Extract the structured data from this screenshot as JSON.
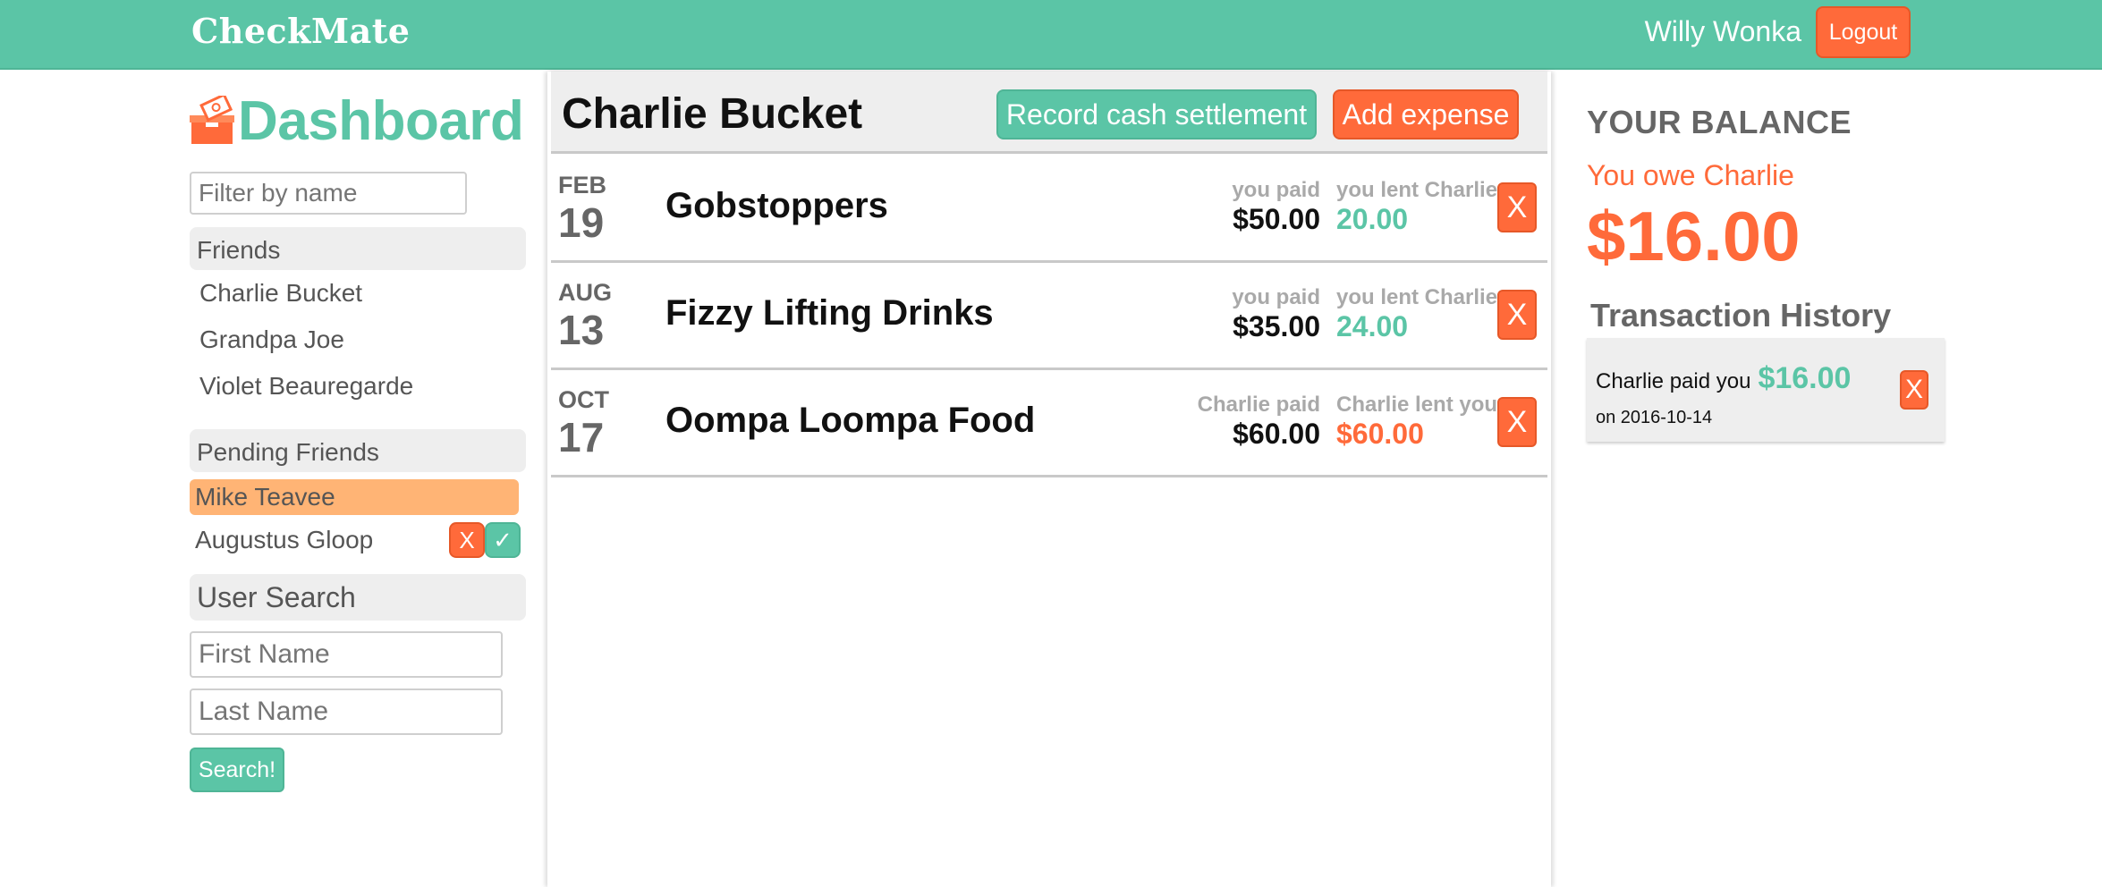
{
  "app": {
    "brand": "CheckMate"
  },
  "header": {
    "username": "Willy Wonka",
    "logout_label": "Logout"
  },
  "sidebar": {
    "title": "Dashboard",
    "filter_placeholder": "Filter by name",
    "friends_header": "Friends",
    "friends": [
      {
        "name": "Charlie Bucket"
      },
      {
        "name": "Grandpa Joe"
      },
      {
        "name": "Violet Beauregarde"
      }
    ],
    "pending_header": "Pending Friends",
    "pending": [
      {
        "name": "Mike Teavee"
      },
      {
        "name": "Augustus Gloop",
        "reject_label": "X",
        "accept_label": "✓"
      }
    ],
    "user_search_header": "User Search",
    "first_name_placeholder": "First Name",
    "last_name_placeholder": "Last Name",
    "search_label": "Search!"
  },
  "main": {
    "friend_name": "Charlie Bucket",
    "settle_label": "Record cash settlement",
    "add_expense_label": "Add expense",
    "expenses": [
      {
        "month": "FEB",
        "day": "19",
        "title": "Gobstoppers",
        "paid_label": "you paid",
        "paid_amount": "$50.00",
        "lent_label": "you lent Charlie",
        "lent_amount": "20.00",
        "lent_color": "green",
        "delete_label": "X"
      },
      {
        "month": "AUG",
        "day": "13",
        "title": "Fizzy Lifting Drinks",
        "paid_label": "you paid",
        "paid_amount": "$35.00",
        "lent_label": "you lent Charlie",
        "lent_amount": "24.00",
        "lent_color": "green",
        "delete_label": "X"
      },
      {
        "month": "OCT",
        "day": "17",
        "title": "Oompa Loompa Food",
        "paid_label": "Charlie paid",
        "paid_amount": "$60.00",
        "lent_label": "Charlie lent you",
        "lent_amount": "$60.00",
        "lent_color": "orange",
        "delete_label": "X"
      }
    ]
  },
  "balance": {
    "title": "YOUR BALANCE",
    "subtitle": "You owe Charlie",
    "amount": "$16.00"
  },
  "history": {
    "title": "Transaction History",
    "items": [
      {
        "text": "Charlie paid you",
        "amount": "$16.00",
        "date": "on 2016-10-14",
        "delete_label": "X"
      }
    ]
  },
  "colors": {
    "accent_green": "#5bc5a6",
    "accent_orange": "#ff6a3a",
    "pending_highlight": "#ffb475"
  }
}
